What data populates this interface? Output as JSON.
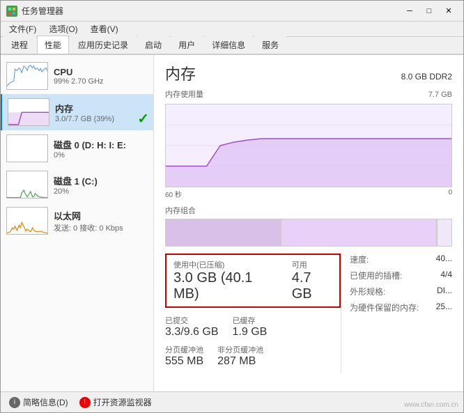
{
  "window": {
    "title": "任务管理器",
    "controls": {
      "minimize": "─",
      "maximize": "□",
      "close": "✕"
    }
  },
  "menu": {
    "items": [
      "文件(F)",
      "选项(O)",
      "查看(V)"
    ]
  },
  "tabs": {
    "items": [
      "进程",
      "性能",
      "应用历史记录",
      "启动",
      "用户",
      "详细信息",
      "服务"
    ],
    "active": "性能"
  },
  "sidebar": {
    "items": [
      {
        "id": "cpu",
        "label": "CPU",
        "sublabel": "99% 2.70 GHz",
        "active": false
      },
      {
        "id": "memory",
        "label": "内存",
        "sublabel": "3.0/7.7 GB (39%)",
        "active": true,
        "checked": true
      },
      {
        "id": "disk0",
        "label": "磁盘 0 (D: H: I: E:",
        "sublabel": "0%",
        "active": false
      },
      {
        "id": "disk1",
        "label": "磁盘 1 (C:)",
        "sublabel": "20%",
        "active": false
      },
      {
        "id": "ethernet",
        "label": "以太网",
        "sublabel": "发送: 0 接收: 0 Kbps",
        "active": false
      }
    ]
  },
  "detail": {
    "title": "内存",
    "spec": "8.0 GB DDR2",
    "chart_label": "内存使用量",
    "chart_value": "7.7 GB",
    "time_labels": [
      "60 秒",
      "0"
    ],
    "composition_label": "内存组合",
    "stats": {
      "in_use_label": "使用中(已压缩)",
      "in_use_value": "3.0 GB (40.1 MB)",
      "available_label": "可用",
      "available_value": "4.7 GB",
      "committed_label": "已提交",
      "committed_value": "3.3/9.6 GB",
      "cached_label": "已缓存",
      "cached_value": "1.9 GB",
      "paged_pool_label": "分页缓冲池",
      "paged_pool_value": "555 MB",
      "nonpaged_pool_label": "非分页缓冲池",
      "nonpaged_pool_value": "287 MB"
    },
    "right_stats": {
      "speed_label": "速度:",
      "speed_value": "40...",
      "slots_label": "已使用的插槽:",
      "slots_value": "4/4",
      "form_label": "外形规格:",
      "form_value": "DI...",
      "reserved_label": "为硬件保留的内存:",
      "reserved_value": "25..."
    }
  },
  "footer": {
    "summary_label": "简略信息(D)",
    "monitor_label": "打开资源监视器"
  },
  "watermark": "www.cfan.com.cn"
}
